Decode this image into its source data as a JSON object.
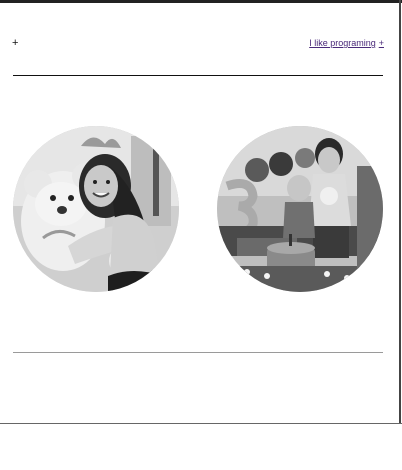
{
  "header": {
    "left_icon": "plus-icon",
    "nav_link_label": "I like programing",
    "nav_link_suffix": "+"
  },
  "colors": {
    "link": "#4a2a7a",
    "rule": "#111111",
    "divider": "#9a9a9a"
  },
  "gallery": {
    "photos": [
      {
        "icon": "photo-girl-with-teddy-bear"
      },
      {
        "icon": "photo-birthday-children-with-cake"
      }
    ]
  }
}
